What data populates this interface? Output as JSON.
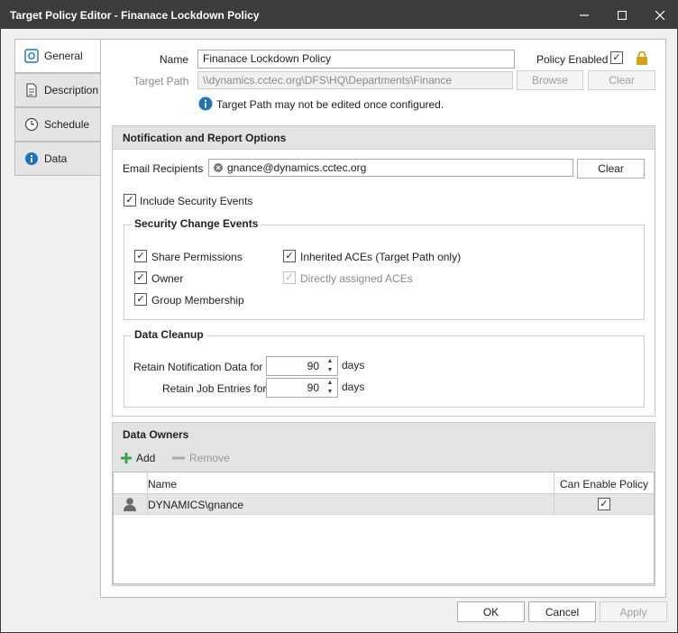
{
  "window": {
    "title": "Target Policy Editor - Finanace Lockdown Policy",
    "controls": {
      "minimize": "—",
      "maximize": "☐",
      "close": "✕"
    }
  },
  "tabs": [
    {
      "label": "General",
      "icon": "general-icon"
    },
    {
      "label": "Description",
      "icon": "document-icon"
    },
    {
      "label": "Schedule",
      "icon": "clock-icon"
    },
    {
      "label": "Data",
      "icon": "info-icon"
    }
  ],
  "general": {
    "name_label": "Name",
    "name_value": "Finanace Lockdown Policy",
    "policy_enabled_label": "Policy Enabled",
    "target_path_label": "Target Path",
    "target_path_value": "\\\\dynamics.cctec.org\\DFS\\HQ\\Departments\\Finance",
    "browse_label": "Browse",
    "clear_label": "Clear",
    "info_text": "Target Path may not be edited once configured."
  },
  "notification": {
    "header": "Notification and Report Options",
    "email_label": "Email Recipients",
    "email_token": "gnance@dynamics.cctec.org",
    "email_clear": "Clear",
    "include_security_events": "Include Security Events",
    "security_group_title": "Security Change Events",
    "share_permissions": "Share Permissions",
    "owner": "Owner",
    "group_membership": "Group Membership",
    "inherited_aces": "Inherited ACEs  (Target Path only)",
    "directly_assigned": "Directly assigned ACEs",
    "cleanup_title": "Data Cleanup",
    "retain_notification_label": "Retain Notification Data for",
    "retain_notification_value": "90",
    "retain_job_label": "Retain Job Entries for",
    "retain_job_value": "90",
    "days": "days"
  },
  "owners": {
    "header": "Data Owners",
    "add_label": "Add",
    "remove_label": "Remove",
    "columns": [
      "Name",
      "Can Enable Policy"
    ],
    "rows": [
      {
        "name": "DYNAMICS\\gnance",
        "can_enable": true
      }
    ]
  },
  "footer": {
    "ok": "OK",
    "cancel": "Cancel",
    "apply": "Apply"
  },
  "colors": {
    "titlebar": "#3c3c3c",
    "accent_blue": "#1e73be",
    "lock_gold": "#d4a017",
    "add_green": "#3aa64a"
  }
}
